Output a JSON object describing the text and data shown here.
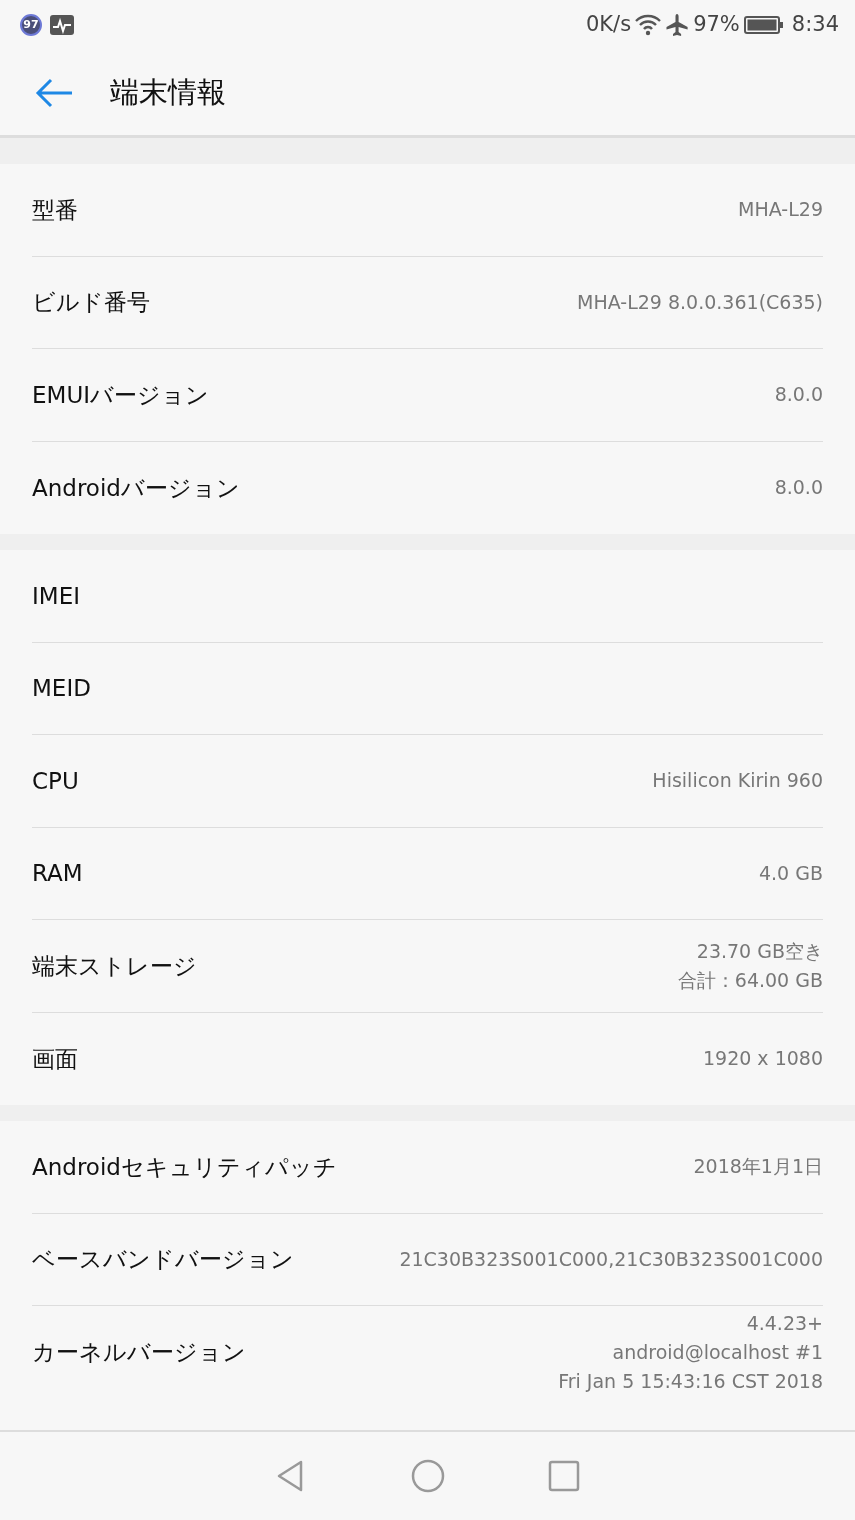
{
  "status_bar": {
    "badge": "97",
    "net_speed": "0K/s",
    "battery": "97%",
    "time": "8:34"
  },
  "header": {
    "title": "端末情報"
  },
  "sections": [
    {
      "rows": [
        {
          "label": "型番",
          "value": [
            "MHA-L29"
          ]
        },
        {
          "label": "ビルド番号",
          "value": [
            "MHA-L29 8.0.0.361(C635)"
          ]
        },
        {
          "label": "EMUIバージョン",
          "value": [
            "8.0.0"
          ]
        },
        {
          "label": "Androidバージョン",
          "value": [
            "8.0.0"
          ]
        }
      ]
    },
    {
      "rows": [
        {
          "label": "IMEI",
          "value": []
        },
        {
          "label": "MEID",
          "value": []
        },
        {
          "label": "CPU",
          "value": [
            "Hisilicon Kirin 960"
          ]
        },
        {
          "label": "RAM",
          "value": [
            "4.0 GB"
          ]
        },
        {
          "label": "端末ストレージ",
          "value": [
            "23.70  GB空き",
            "合計：64.00  GB"
          ]
        },
        {
          "label": "画面",
          "value": [
            "1920 x 1080"
          ]
        }
      ]
    },
    {
      "rows": [
        {
          "label": "Androidセキュリティパッチ",
          "value": [
            "2018年1月1日"
          ]
        },
        {
          "label": "ベースバンドバージョン",
          "value": [
            "21C30B323S001C000,21C30B323S001C000"
          ]
        },
        {
          "label": "カーネルバージョン",
          "value": [
            "4.4.23+",
            "android@localhost #1",
            "Fri Jan 5 15:43:16 CST 2018"
          ]
        }
      ]
    }
  ]
}
